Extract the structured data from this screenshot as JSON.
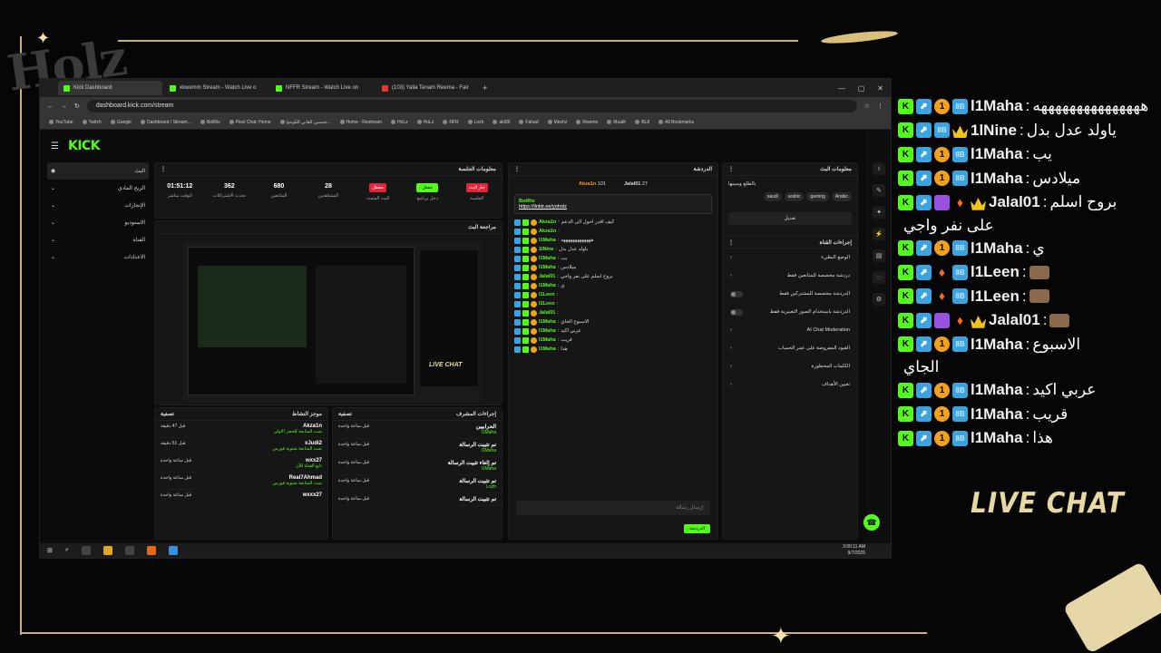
{
  "overlay": {
    "brand": "Holz",
    "live_chat_title": "LIVE CHAT",
    "chat": [
      {
        "user": "l1Maha",
        "msg": "هههههههههههههههه",
        "badges": [
          "k",
          "b",
          "o",
          "c"
        ]
      },
      {
        "user": "1lNine",
        "msg": "ياولد عدل بدل",
        "badges": [
          "k",
          "b",
          "c",
          "cr"
        ]
      },
      {
        "user": "l1Maha",
        "msg": "يب",
        "badges": [
          "k",
          "b",
          "o",
          "c"
        ]
      },
      {
        "user": "l1Maha",
        "msg": "ميلادس",
        "badges": [
          "k",
          "b",
          "o",
          "c"
        ]
      },
      {
        "user": "Jalal01",
        "msg": "بروح اسلم",
        "badges": [
          "k",
          "b",
          "p",
          "fire",
          "cr"
        ],
        "cont": "على نفر واجي"
      },
      {
        "user": "l1Maha",
        "msg": "ي",
        "badges": [
          "k",
          "b",
          "o",
          "c"
        ]
      },
      {
        "user": "l1Leen",
        "msg": "",
        "badges": [
          "k",
          "b",
          "fire",
          "c",
          "av"
        ]
      },
      {
        "user": "l1Leen",
        "msg": "",
        "badges": [
          "k",
          "b",
          "fire",
          "c",
          "av"
        ]
      },
      {
        "user": "Jalal01",
        "msg": "",
        "badges": [
          "k",
          "b",
          "p",
          "fire",
          "cr",
          "av"
        ]
      },
      {
        "user": "l1Maha",
        "msg": "الاسبوع",
        "badges": [
          "k",
          "b",
          "o",
          "c"
        ],
        "cont": "الجاي"
      },
      {
        "user": "l1Maha",
        "msg": "عربي اكيد",
        "badges": [
          "k",
          "b",
          "o",
          "c"
        ]
      },
      {
        "user": "l1Maha",
        "msg": "قريب",
        "badges": [
          "k",
          "b",
          "o",
          "c"
        ]
      },
      {
        "user": "l1Maha",
        "msg": "هذا",
        "badges": [
          "k",
          "b",
          "o",
          "c"
        ]
      }
    ]
  },
  "browser": {
    "tabs": [
      "Kick Dashboard",
      "xkwemm Stream - Watch Live o",
      "NFFR Stream - Watch Live on",
      "(103) Yalla Tenam Reema - Fair"
    ],
    "url": "dashboard.kick.com/stream",
    "bookmarks": [
      "YouTube",
      "Twitch",
      "Google",
      "Dashboard / Stream...",
      "BotRix",
      "Pixel Chat: Home",
      "تحسين القاني الكونتوا...",
      "Home - Restream",
      "HoLz",
      "HoLz",
      "NFR",
      "Lozh",
      "ak90l",
      "Fahad",
      "Meshz",
      "Rwemn",
      "Muath",
      "BL8",
      "All Bookmarks"
    ]
  },
  "kick": {
    "logo": "KICK",
    "sidebar": [
      "البث",
      "الربح المادي",
      "الإنجازات",
      "الاستوديو",
      "القناة",
      "الاعدادات"
    ],
    "session": {
      "title": "معلومات الجلسة",
      "stats": [
        {
          "label": "الوقت مباشر",
          "value": "01:51:12"
        },
        {
          "label": "تحدث الاشتراكات",
          "value": "362"
        },
        {
          "label": "المتابعين",
          "value": "680"
        },
        {
          "label": "المشاهدين",
          "value": "28"
        }
      ],
      "buttons": [
        "البث المتعدد",
        "دخل برنامج",
        "الجلسة"
      ],
      "btn_tags": [
        "معطل",
        "مفعل",
        "جار البث"
      ]
    },
    "preview_title": "مراجعة البث",
    "activity": {
      "title": "موجز النشاط",
      "filter": "تصفية",
      "rows": [
        {
          "user": "Akza1n",
          "action": "تمت المتابعة للحجز الاولى",
          "time": "قبل 47 دقيقة"
        },
        {
          "user": "xJudi2",
          "action": "تمت المتابعة شتوية فورس",
          "time": "قبل 51 دقيقة"
        },
        {
          "user": "wxx27",
          "action": "تابع القناة للآن",
          "time": "قبل ساعة واحدة"
        },
        {
          "user": "Real7Ahmad",
          "action": "تمت المتابعة شتوية فورس",
          "time": "قبل ساعة واحدة"
        },
        {
          "user": "wxxx27",
          "action": "",
          "time": "قبل ساعة واحدة"
        }
      ]
    },
    "modactions": {
      "title": "إجراءات المشرف",
      "filter": "تصفية",
      "rows": [
        {
          "user": "الحرابيين",
          "action": "l1Maha",
          "time": "قبل ساعة واحدة"
        },
        {
          "user": "تم تثبيت الرسالة",
          "action": "l1Maha",
          "time": "قبل ساعة واحدة"
        },
        {
          "user": "تم إلغاء تثبيت الرسالة",
          "action": "l1Maha",
          "time": "قبل ساعة واحدة"
        },
        {
          "user": "تم تثبيت الرسالة",
          "action": "Lozh",
          "time": "قبل ساعة واحدة"
        },
        {
          "user": "تم تثبيت الرسالة",
          "action": "",
          "time": "قبل ساعة واحدة"
        }
      ]
    },
    "chat": {
      "title": "الدردشة",
      "top_user": "Akza1n",
      "top_count": "101",
      "top2_user": "Jalal01",
      "top2_count": "27",
      "pinned_by": "BotRix",
      "pinned_link": "https://linktr.ee/yoholz",
      "lines": [
        {
          "user": "Akza1n",
          "msg": "كيف اقدر احول الى الدعم"
        },
        {
          "user": "Akza1n",
          "msg": ""
        },
        {
          "user": "l1Maha",
          "msg": "هههههههههههههه"
        },
        {
          "user": "1lNine",
          "msg": "ياولد عدل بدل"
        },
        {
          "user": "l1Maha",
          "msg": "يب"
        },
        {
          "user": "l1Maha",
          "msg": "ميلادس"
        },
        {
          "user": "Jalal01",
          "msg": "بروح اسلم على نفر واجي"
        },
        {
          "user": "l1Maha",
          "msg": "ي"
        },
        {
          "user": "l1Leen",
          "msg": ""
        },
        {
          "user": "l1Leen",
          "msg": ""
        },
        {
          "user": "Jalal01",
          "msg": ""
        },
        {
          "user": "l1Maha",
          "msg": "الاسبوع الجاي"
        },
        {
          "user": "l1Maha",
          "msg": "عربي اكيد"
        },
        {
          "user": "l1Maha",
          "msg": "قريب"
        },
        {
          "user": "l1Maha",
          "msg": "هذا"
        }
      ],
      "placeholder": "إرسال رسالة",
      "send": "الدردشة"
    },
    "info": {
      "title": "معلومات البث",
      "stream_title": "بالطلع وسينها",
      "tags": [
        "saudi",
        "arabic",
        "gaming",
        "Arabic"
      ],
      "edit": "تعديل",
      "actions_title": "إجراءات القناة",
      "actions": [
        "الوضع البطيء",
        "دردشة مخصصة للمتابعين فقط",
        "الدردشة مخصصة للمشتركين فقط",
        "الدردشة باستخدام الصور التعبيرية فقط",
        "AI Chat Moderation",
        "القيود المفروضة على عمر الحساب",
        "الكلمات المحظورة",
        "تعيين الأهداف"
      ]
    },
    "clock": "3:00:11 AM",
    "date": "9/7/2025"
  }
}
